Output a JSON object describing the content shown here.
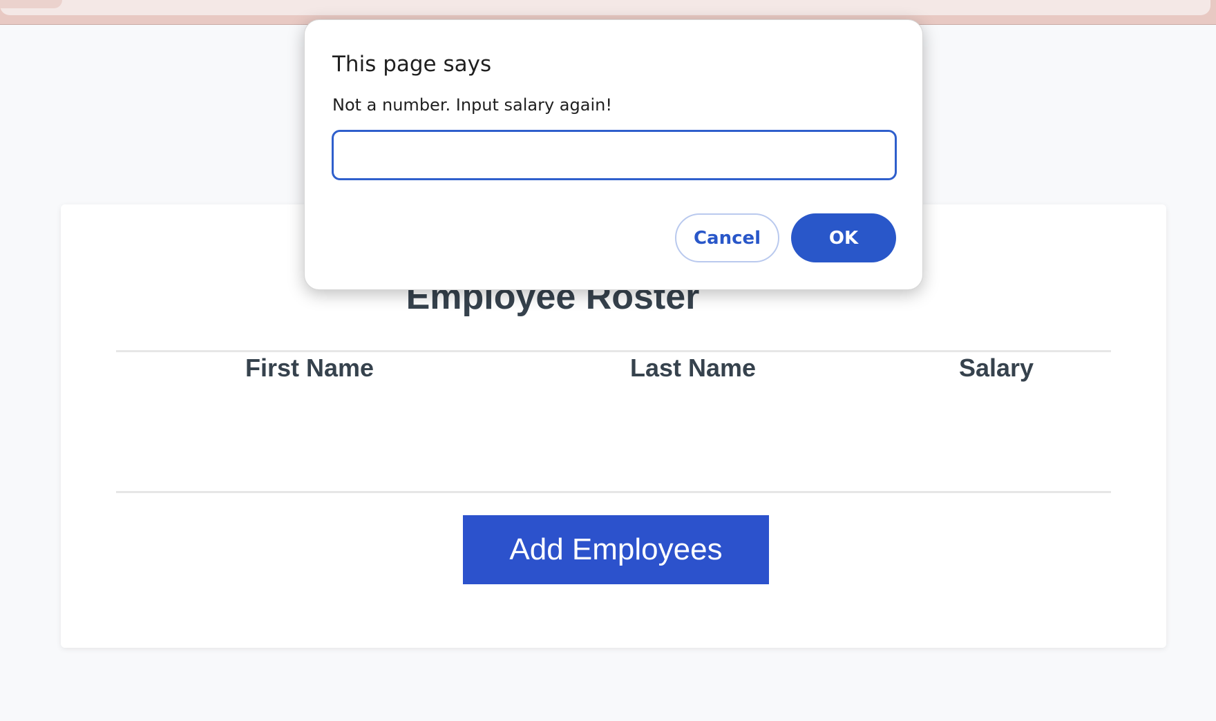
{
  "page": {
    "title": "Employee Roster",
    "columns": [
      "First Name",
      "Last Name",
      "Salary"
    ],
    "add_button": "Add Employees"
  },
  "dialog": {
    "title": "This page says",
    "message": "Not a number. Input salary again!",
    "input_value": "",
    "cancel_label": "Cancel",
    "ok_label": "OK"
  },
  "colors": {
    "accent": "#2c52cc",
    "dialog_accent": "#2957c9",
    "text": "#36424d"
  }
}
